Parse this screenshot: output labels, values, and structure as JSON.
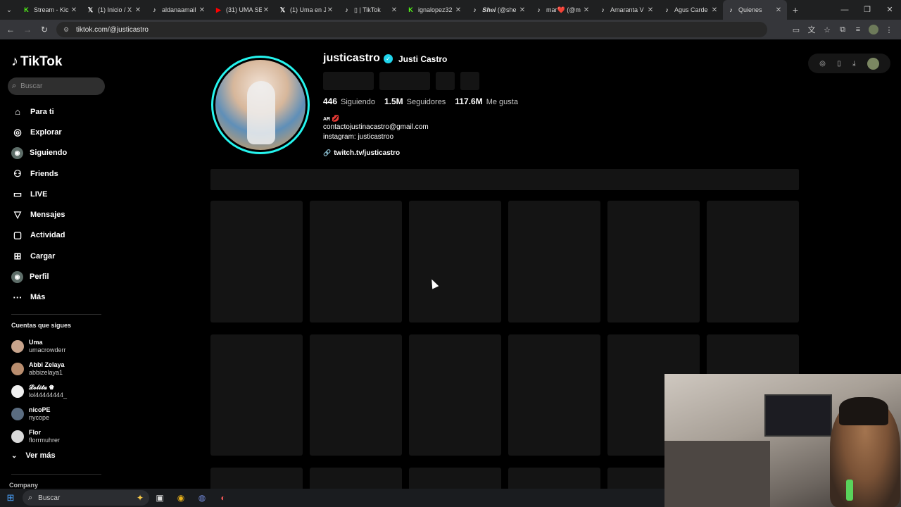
{
  "browser": {
    "tabs": [
      {
        "icon": "kick-icon",
        "title": "Stream - Kic",
        "color": "#53fc18"
      },
      {
        "icon": "x-icon",
        "title": "(1) Inicio / X",
        "color": "#ffffff"
      },
      {
        "icon": "tiktok-icon",
        "title": "aldanaamail",
        "color": "#ffffff"
      },
      {
        "icon": "youtube-icon",
        "title": "(31) UMA SE",
        "color": "#ff0000"
      },
      {
        "icon": "x-icon",
        "title": "(1) Uma en J",
        "color": "#ffffff"
      },
      {
        "icon": "tiktok-icon",
        "title": "▯ | TikTok",
        "color": "#ffffff"
      },
      {
        "icon": "kick-icon",
        "title": "ignalopez32",
        "color": "#53fc18"
      },
      {
        "icon": "tiktok-icon",
        "title": "𝑺𝒉𝒆𝒊 (@she",
        "color": "#ffffff"
      },
      {
        "icon": "tiktok-icon",
        "title": "mar❤️ (@m",
        "color": "#ffffff"
      },
      {
        "icon": "tiktok-icon",
        "title": "Amaranta V",
        "color": "#ffffff"
      },
      {
        "icon": "tiktok-icon",
        "title": "Agus Carde",
        "color": "#ffffff"
      },
      {
        "icon": "tiktok-icon",
        "title": "Quienes",
        "color": "#ffffff",
        "active": true
      }
    ],
    "url": "tiktok.com/@justicastro"
  },
  "sidebar": {
    "logo": "TikTok",
    "search_placeholder": "Buscar",
    "nav": [
      {
        "label": "Para ti",
        "icon": "home-icon"
      },
      {
        "label": "Explorar",
        "icon": "compass-icon"
      },
      {
        "label": "Siguiendo",
        "icon": "following-avatar-icon"
      },
      {
        "label": "Friends",
        "icon": "friends-icon"
      },
      {
        "label": "LIVE",
        "icon": "live-icon"
      },
      {
        "label": "Mensajes",
        "icon": "messages-icon"
      },
      {
        "label": "Actividad",
        "icon": "activity-icon"
      },
      {
        "label": "Cargar",
        "icon": "upload-icon"
      },
      {
        "label": "Perfil",
        "icon": "profile-avatar-icon"
      },
      {
        "label": "Más",
        "icon": "more-icon"
      }
    ],
    "following_header": "Cuentas que sigues",
    "following": [
      {
        "name": "Uma",
        "user": "umacrowderr",
        "color": "#c8a48c"
      },
      {
        "name": "Abbi Zelaya",
        "user": "abbizelaya1",
        "color": "#b98d6e"
      },
      {
        "name": "𝓛𝓸𝓵𝓲𝓽𝓪 ♛",
        "user": "lol44444444_",
        "color": "#f0f0f0"
      },
      {
        "name": "nicoPE",
        "user": "nycope",
        "color": "#5a6c80"
      },
      {
        "name": "Flor",
        "user": "florrmuhrer",
        "color": "#d9d9d9"
      }
    ],
    "see_more": "Ver más",
    "company": "Company"
  },
  "profile": {
    "username": "justicastro",
    "display_name": "Justi Castro",
    "stats": [
      {
        "value": "446",
        "label": "Siguiendo"
      },
      {
        "value": "1.5M",
        "label": "Seguidores"
      },
      {
        "value": "117.6M",
        "label": "Me gusta"
      }
    ],
    "bio_country": "AR",
    "bio_email": "contactojustinacastro@gmail.com",
    "bio_instagram": "instagram: justicastroo",
    "link": "twitch.tv/justicastro"
  },
  "taskbar": {
    "search": "Buscar"
  }
}
